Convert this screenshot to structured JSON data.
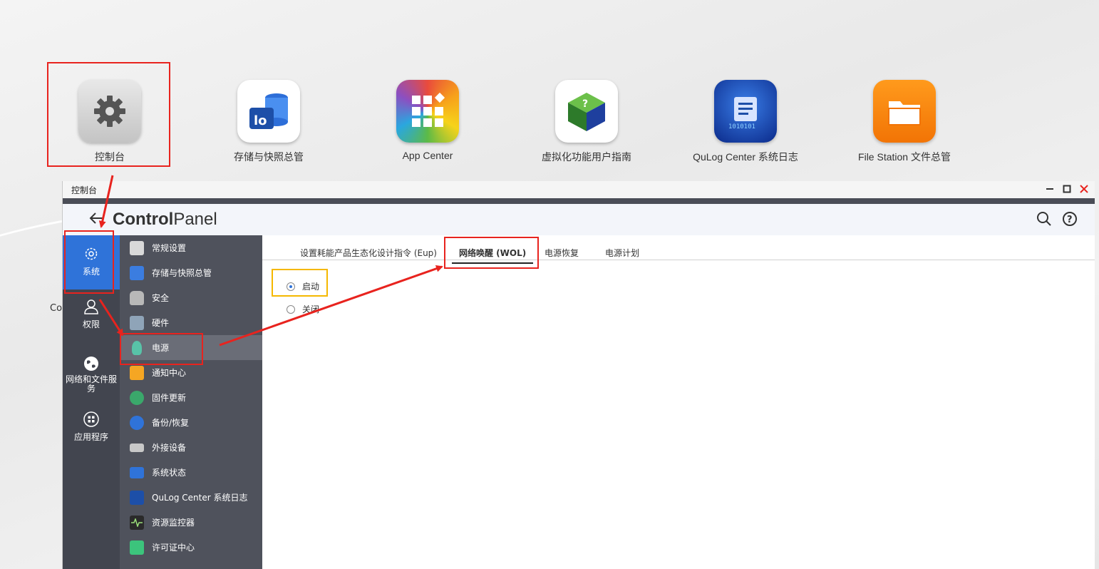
{
  "desktop": {
    "icons": [
      {
        "label": "控制台"
      },
      {
        "label": "存储与快照总管"
      },
      {
        "label": "App Center"
      },
      {
        "label": "虚拟化功能用户指南"
      },
      {
        "label": "QuLog Center 系统日志"
      },
      {
        "label": "File Station 文件总管"
      }
    ],
    "stray_text": "Co"
  },
  "window": {
    "title": "控制台",
    "brand_bold": "Control",
    "brand_light": "Panel"
  },
  "leftnav": {
    "items": [
      {
        "label": "系统",
        "icon": "gear-icon"
      },
      {
        "label": "权限",
        "icon": "user-icon"
      },
      {
        "label": "网络和文件服务",
        "icon": "globe-icon"
      },
      {
        "label": "应用程序",
        "icon": "apps-icon"
      }
    ]
  },
  "menu": {
    "items": [
      {
        "label": "常规设置"
      },
      {
        "label": "存储与快照总管"
      },
      {
        "label": "安全"
      },
      {
        "label": "硬件"
      },
      {
        "label": "电源"
      },
      {
        "label": "通知中心"
      },
      {
        "label": "固件更新"
      },
      {
        "label": "备份/恢复"
      },
      {
        "label": "外接设备"
      },
      {
        "label": "系统状态"
      },
      {
        "label": "QuLog Center 系统日志"
      },
      {
        "label": "资源监控器"
      },
      {
        "label": "许可证中心"
      }
    ]
  },
  "tabs": [
    {
      "label": "设置耗能产品生态化设计指令 (Eup)"
    },
    {
      "label": "网络唤醒 (WOL)"
    },
    {
      "label": "电源恢复"
    },
    {
      "label": "电源计划"
    }
  ],
  "wol": {
    "options": [
      {
        "label": "启动",
        "selected": true
      },
      {
        "label": "关闭",
        "selected": false
      }
    ]
  },
  "colors": {
    "accent": "#2f73d9",
    "annotation_red": "#e8231e",
    "annotation_yellow": "#f5b800"
  }
}
